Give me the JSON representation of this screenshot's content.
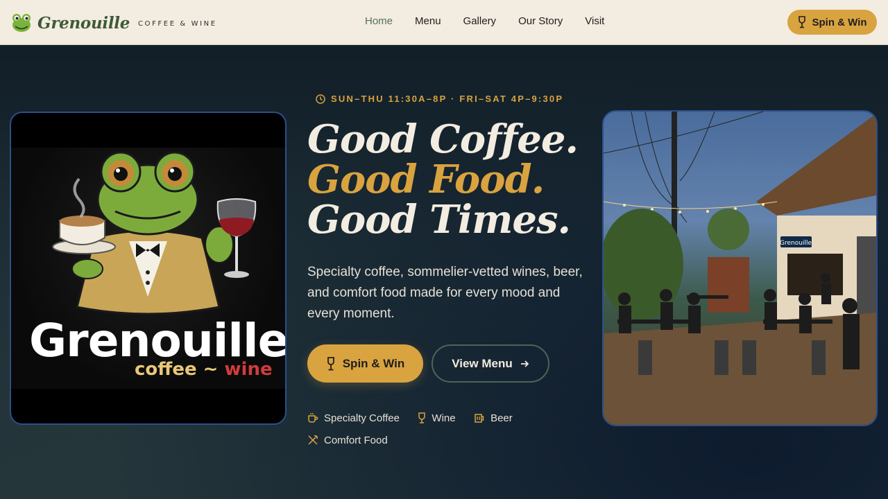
{
  "header": {
    "brand_name": "Grenouille",
    "brand_tagline": "COFFEE & WINE",
    "nav": [
      {
        "label": "Home",
        "active": true
      },
      {
        "label": "Menu"
      },
      {
        "label": "Gallery"
      },
      {
        "label": "Our Story"
      },
      {
        "label": "Visit"
      }
    ],
    "cta_label": "Spin & Win"
  },
  "logo_card": {
    "wordmark": "Grenouille",
    "sub_coffee": "coffee",
    "sub_sep": "~",
    "sub_wine": "wine"
  },
  "hero": {
    "hours": "SUN–THU 11:30A–8P · FRI–SAT 4P–9:30P",
    "line1": "Good Coffee.",
    "line2": "Good Food.",
    "line3": "Good Times.",
    "description": "Specialty coffee, sommelier-vetted wines, beer, and comfort food made for every mood and every moment.",
    "primary_button": "Spin & Win",
    "secondary_button": "View Menu"
  },
  "features": [
    {
      "label": "Specialty Coffee",
      "icon": "coffee-cup-icon"
    },
    {
      "label": "Wine",
      "icon": "wine-glass-icon"
    },
    {
      "label": "Beer",
      "icon": "beer-mug-icon"
    },
    {
      "label": "Comfort Food",
      "icon": "utensils-icon"
    }
  ],
  "photo": {
    "sign_text": "Grenouille"
  },
  "colors": {
    "accent_gold": "#d9a340",
    "header_bg": "#f3ece0",
    "brand_green": "#3e5a38",
    "card_border": "#2d4f8a"
  }
}
